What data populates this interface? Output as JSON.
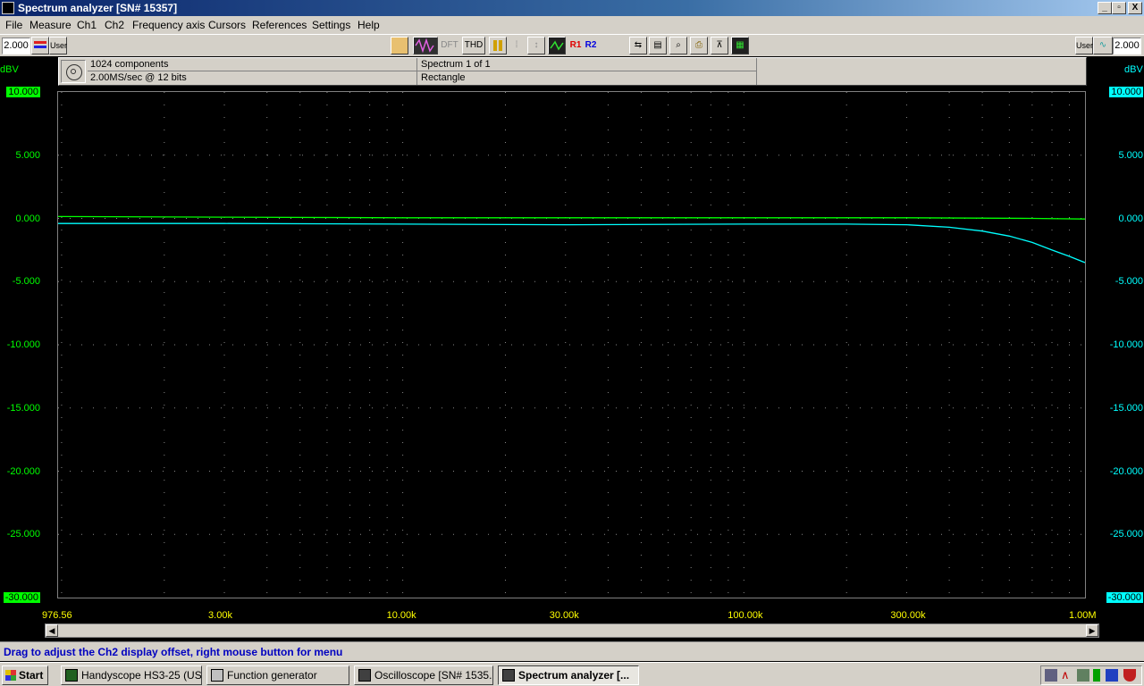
{
  "window": {
    "title": "Spectrum analyzer  [SN# 15357]",
    "btn_min": "_",
    "btn_max": "▫",
    "btn_close": "X"
  },
  "menu": [
    "File",
    "Measure",
    "Ch1",
    "Ch2",
    "Frequency axis",
    "Cursors",
    "References",
    "Settings",
    "Help"
  ],
  "toolbar": {
    "ch1_range": "2.000",
    "ch1_user": "User",
    "dft": "DFT",
    "thd": "THD",
    "r1": "R1",
    "r2": "R2",
    "ch2_user": "User",
    "ch2_range": "2.000"
  },
  "info": {
    "components": "1024 components",
    "rate": "2.00MS/sec @ 12 bits",
    "spectrum": "Spectrum 1 of 1",
    "window": "Rectangle"
  },
  "axis": {
    "unit_left": "dBV",
    "unit_right": "dBV",
    "y_left": [
      "10.000",
      "5.000",
      "0.000",
      "-5.000",
      "-10.000",
      "-15.000",
      "-20.000",
      "-25.000",
      "-30.000"
    ],
    "y_right": [
      "10.000",
      "5.000",
      "0.000",
      "-5.000",
      "-10.000",
      "-15.000",
      "-20.000",
      "-25.000",
      "-30.000"
    ],
    "x": [
      "976.56",
      "3.00k",
      "10.00k",
      "30.00k",
      "100.00k",
      "300.00k",
      "1.00M"
    ]
  },
  "chart_data": {
    "type": "line",
    "xlabel": "",
    "ylabel": "dBV",
    "x_scale": "log",
    "xlim": [
      976.56,
      1000000
    ],
    "ylim": [
      -30,
      10
    ],
    "grid": true,
    "series": [
      {
        "color": "#00ff00",
        "x": [
          976.56,
          3000,
          10000,
          100000,
          300000,
          700000,
          1000000
        ],
        "y": [
          0.15,
          0.1,
          0.05,
          0.05,
          0.05,
          0.0,
          -0.05
        ]
      },
      {
        "color": "#00ffff",
        "x": [
          976.56,
          3000,
          10000,
          30000,
          100000,
          200000,
          300000,
          400000,
          500000,
          600000,
          700000,
          800000,
          900000,
          1000000
        ],
        "y": [
          -0.4,
          -0.4,
          -0.45,
          -0.5,
          -0.45,
          -0.45,
          -0.5,
          -0.7,
          -1.0,
          -1.4,
          -1.9,
          -2.5,
          -3.0,
          -3.5
        ]
      }
    ]
  },
  "status": "Drag to adjust the Ch2 display offset, right mouse button for menu",
  "taskbar": {
    "start": "Start",
    "tasks": [
      "Handyscope HS3-25 (US...",
      "Function generator",
      "Oscilloscope  [SN# 1535...",
      "Spectrum analyzer  [..."
    ]
  },
  "colors": {
    "ch1": "#00ff00",
    "ch2": "#00ffff",
    "status_text": "#0000c0",
    "x_labels": "#ffff00"
  }
}
